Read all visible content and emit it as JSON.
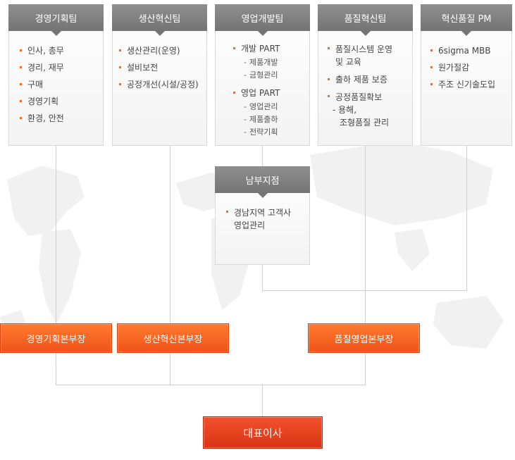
{
  "teams": [
    {
      "title": "경영기획팀",
      "items": [
        "인사, 총무",
        "경리, 재무",
        "구매",
        "경영기획",
        "환경, 안전"
      ]
    },
    {
      "title": "생산혁신팀",
      "items": [
        "생산관리(운영)",
        "설비보전",
        "공정개선(시설/공정)"
      ]
    },
    {
      "title": "영업개발팀",
      "parts": [
        {
          "label": "개발 PART",
          "subs": [
            "제품개발",
            "금형관리"
          ]
        },
        {
          "label": "영업 PART",
          "subs": [
            "영업관리",
            "제품출하",
            "전략기획"
          ]
        }
      ]
    },
    {
      "title": "품질혁신팀",
      "items": [
        {
          "line1": "품질시스템 운영",
          "line2": "및 교육"
        },
        "출하 제품 보증",
        {
          "line1": "공정품질확보",
          "line2": "- 용해,",
          "line3": "조형품질 관리"
        }
      ]
    },
    {
      "title": "혁신품질 PM",
      "items": [
        "6sigma MBB",
        "원가절감",
        "주조 신기술도입"
      ]
    }
  ],
  "branch": {
    "title": "남부지점",
    "line1": "경남지역 고객사",
    "line2": "영업관리"
  },
  "divisions": [
    "경영기획본부장",
    "생산혁신본부장",
    "품질영업본부장"
  ],
  "ceo": "대표이사",
  "colors": {
    "accent": "#f26b21",
    "header": "#7f7f7f",
    "ceo": "#e43f1e"
  }
}
